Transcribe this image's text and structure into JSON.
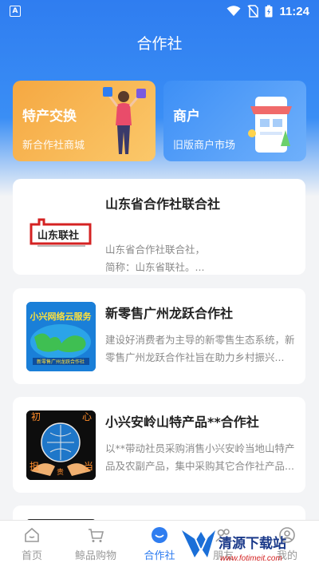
{
  "status_bar": {
    "time": "11:24"
  },
  "header": {
    "title": "合作社"
  },
  "top_cards": [
    {
      "title": "特产交换",
      "subtitle": "新合作社商城"
    },
    {
      "title": "商户",
      "subtitle": "旧版商户市场"
    }
  ],
  "items": [
    {
      "name": "山东省合作社联合社",
      "desc": "山东省合作社联合社，\n简称：山东省联社。...",
      "logo_text": "山东联社"
    },
    {
      "name": "新零售广州龙跃合作社",
      "desc": "建设好消费者为主导的新零售生态系统，新零售广州龙跃合作社旨在助力乡村振兴...",
      "logo_text": "小兴网络云服务",
      "logo_sub": "新零售广州龙跃合作社"
    },
    {
      "name": "小兴安岭山特产品**合作社",
      "desc": "以**带动社员采购消售小兴安岭当地山特产品及农副产品，集中采购其它合作社产品...",
      "logo_chars": [
        "初",
        "心",
        "担",
        "责",
        "当"
      ]
    }
  ],
  "tabs": [
    {
      "label": "首页",
      "icon": "home-icon"
    },
    {
      "label": "鲸品购物",
      "icon": "cart-icon"
    },
    {
      "label": "合作社",
      "icon": "coop-icon",
      "active": true
    },
    {
      "label": "朋友",
      "icon": "friends-icon"
    },
    {
      "label": "我的",
      "icon": "profile-icon"
    }
  ],
  "watermark": {
    "text": "清源下载站",
    "url": "www.fotimeit.com"
  },
  "colors": {
    "primary": "#2f7df0",
    "orange_card": "#f5a842",
    "blue_card": "#3d8ff6"
  }
}
